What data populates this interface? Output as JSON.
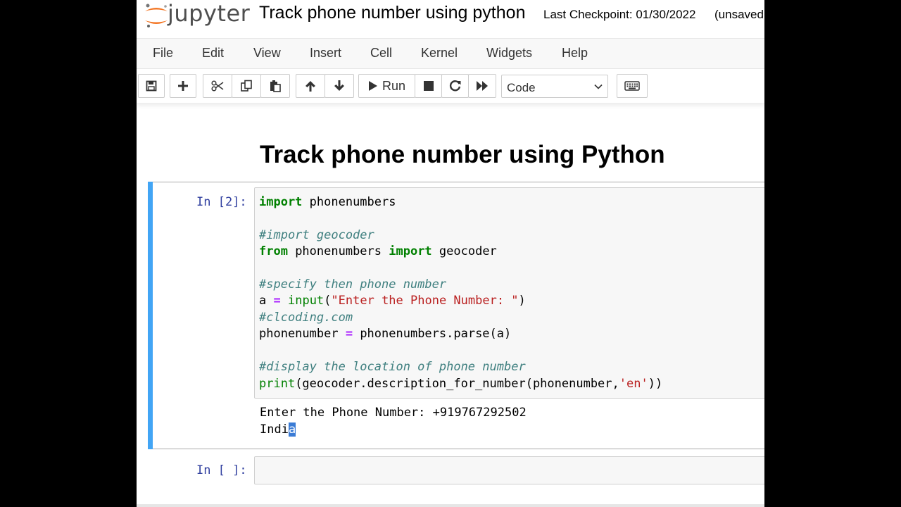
{
  "header": {
    "logo_text": "jupyter",
    "notebook_title": "Track phone number using python",
    "checkpoint": "Last Checkpoint: 01/30/2022",
    "save_status": "(unsaved"
  },
  "menu": [
    "File",
    "Edit",
    "View",
    "Insert",
    "Cell",
    "Kernel",
    "Widgets",
    "Help"
  ],
  "toolbar": {
    "run_label": "Run",
    "cell_type": "Code"
  },
  "notebook": {
    "heading": "Track phone number using Python",
    "cell1": {
      "prompt": "In [2]:",
      "code": {
        "l1_kw": "import",
        "l1_rest": " phonenumbers",
        "l2_comment": "#import geocoder",
        "l3_kw1": "from",
        "l3_mid": " phonenumbers ",
        "l3_kw2": "import",
        "l3_rest": " geocoder",
        "l4_comment": "#specify then phone number",
        "l5_var": "a ",
        "l5_op": "=",
        "l5_sp": " ",
        "l5_fn": "input",
        "l5_p1": "(",
        "l5_str": "\"Enter the Phone Number: \"",
        "l5_p2": ")",
        "l6_comment": "#clcoding.com",
        "l7_var": "phonenumber ",
        "l7_op": "=",
        "l7_rest": " phonenumbers.parse(a)",
        "l8_comment": "#display the location of phone number",
        "l9_fn": "print",
        "l9_mid": "(geocoder.description_for_number(phonenumber,",
        "l9_str": "'en'",
        "l9_end": "))"
      },
      "output": {
        "line1": "Enter the Phone Number: +919767292502",
        "line2_main": "Indi",
        "line2_sel": "a"
      }
    },
    "cell2": {
      "prompt": "In [ ]:"
    }
  }
}
